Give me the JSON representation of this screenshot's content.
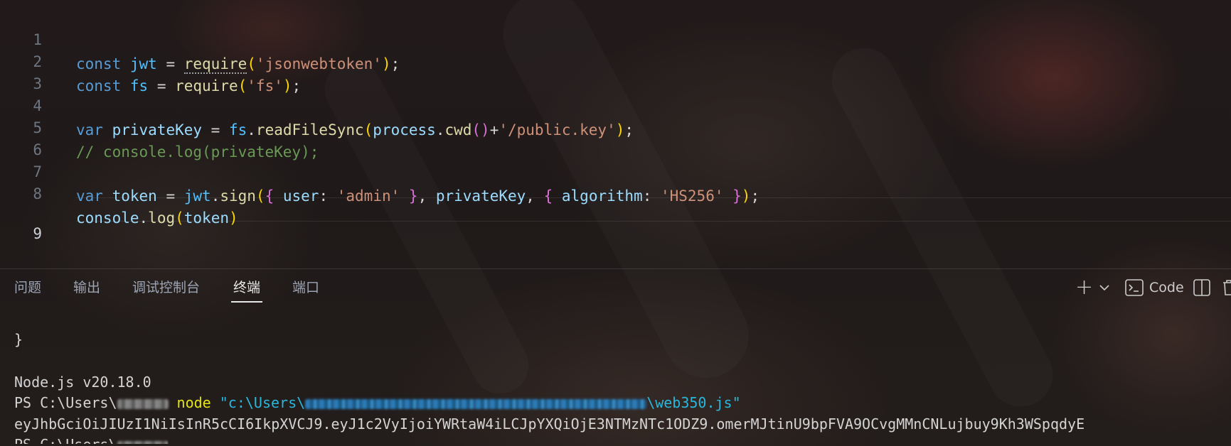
{
  "editor": {
    "active_line": 9,
    "lines": [
      {
        "n": "1"
      },
      {
        "n": "2"
      },
      {
        "n": "3"
      },
      {
        "n": "4"
      },
      {
        "n": "5"
      },
      {
        "n": "6"
      },
      {
        "n": "7"
      },
      {
        "n": "8"
      },
      {
        "n": "9"
      }
    ],
    "code": {
      "l1": {
        "kw": "const",
        "name": "jwt",
        "eq": " = ",
        "fn": "require",
        "open": "(",
        "str": "'jsonwebtoken'",
        "close": ")",
        "semi": ";"
      },
      "l2": {
        "kw": "const",
        "name": "fs",
        "eq": " = ",
        "fn": "require",
        "open": "(",
        "str": "'fs'",
        "close": ")",
        "semi": ";"
      },
      "l4": {
        "kw": "var",
        "name": "privateKey",
        "eq": " = ",
        "obj": "fs",
        "dot": ".",
        "fn": "readFileSync",
        "open": "(",
        "obj2": "process",
        "dot2": ".",
        "fn2": "cwd",
        "inner": "()",
        "plus": "+",
        "str": "'/public.key'",
        "close": ")",
        "semi": ";"
      },
      "l5": {
        "comment": "// console.log(privateKey);"
      },
      "l7": {
        "kw": "var",
        "name": "token",
        "eq": " = ",
        "obj": "jwt",
        "dot": ".",
        "fn": "sign",
        "open": "(",
        "b1": "{ ",
        "key1": "user",
        "colon1": ": ",
        "str1": "'admin'",
        "b1c": " }",
        "comma1": ", ",
        "arg2": "privateKey",
        "comma2": ", ",
        "b2": "{ ",
        "key2": "algorithm",
        "colon2": ": ",
        "str2": "'HS256'",
        "b2c": " }",
        "close": ")",
        "semi": ";"
      },
      "l8": {
        "obj": "console",
        "dot": ".",
        "fn": "log",
        "open": "(",
        "arg": "token",
        "close": ")"
      }
    }
  },
  "panel": {
    "tabs": [
      {
        "label": "问题"
      },
      {
        "label": "输出"
      },
      {
        "label": "调试控制台"
      },
      {
        "label": "终端",
        "active": true
      },
      {
        "label": "端口"
      }
    ],
    "toolbar": {
      "plus": "+",
      "chevron": "⌵",
      "terminal_name": "Code"
    },
    "terminal": {
      "brace": "}",
      "node_version": "Node.js v20.18.0",
      "prompt_prefix": "PS C:\\Users\\",
      "cmd": "node",
      "path_start": "\"c:\\Users\\",
      "path_end": "\\web350.js\"",
      "token": "eyJhbGciOiJIUzI1NiIsInR5cCI6IkpXVCJ9.eyJ1c2VyIjoiYWRtaW4iLCJpYXQiOjE3NTMzNTc1ODZ9.omerMJtinU9bpFVA9OCvgMMnCNLujbuy9Kh3WSpqdyE",
      "next_prompt": "PS C:\\Users\\"
    }
  }
}
